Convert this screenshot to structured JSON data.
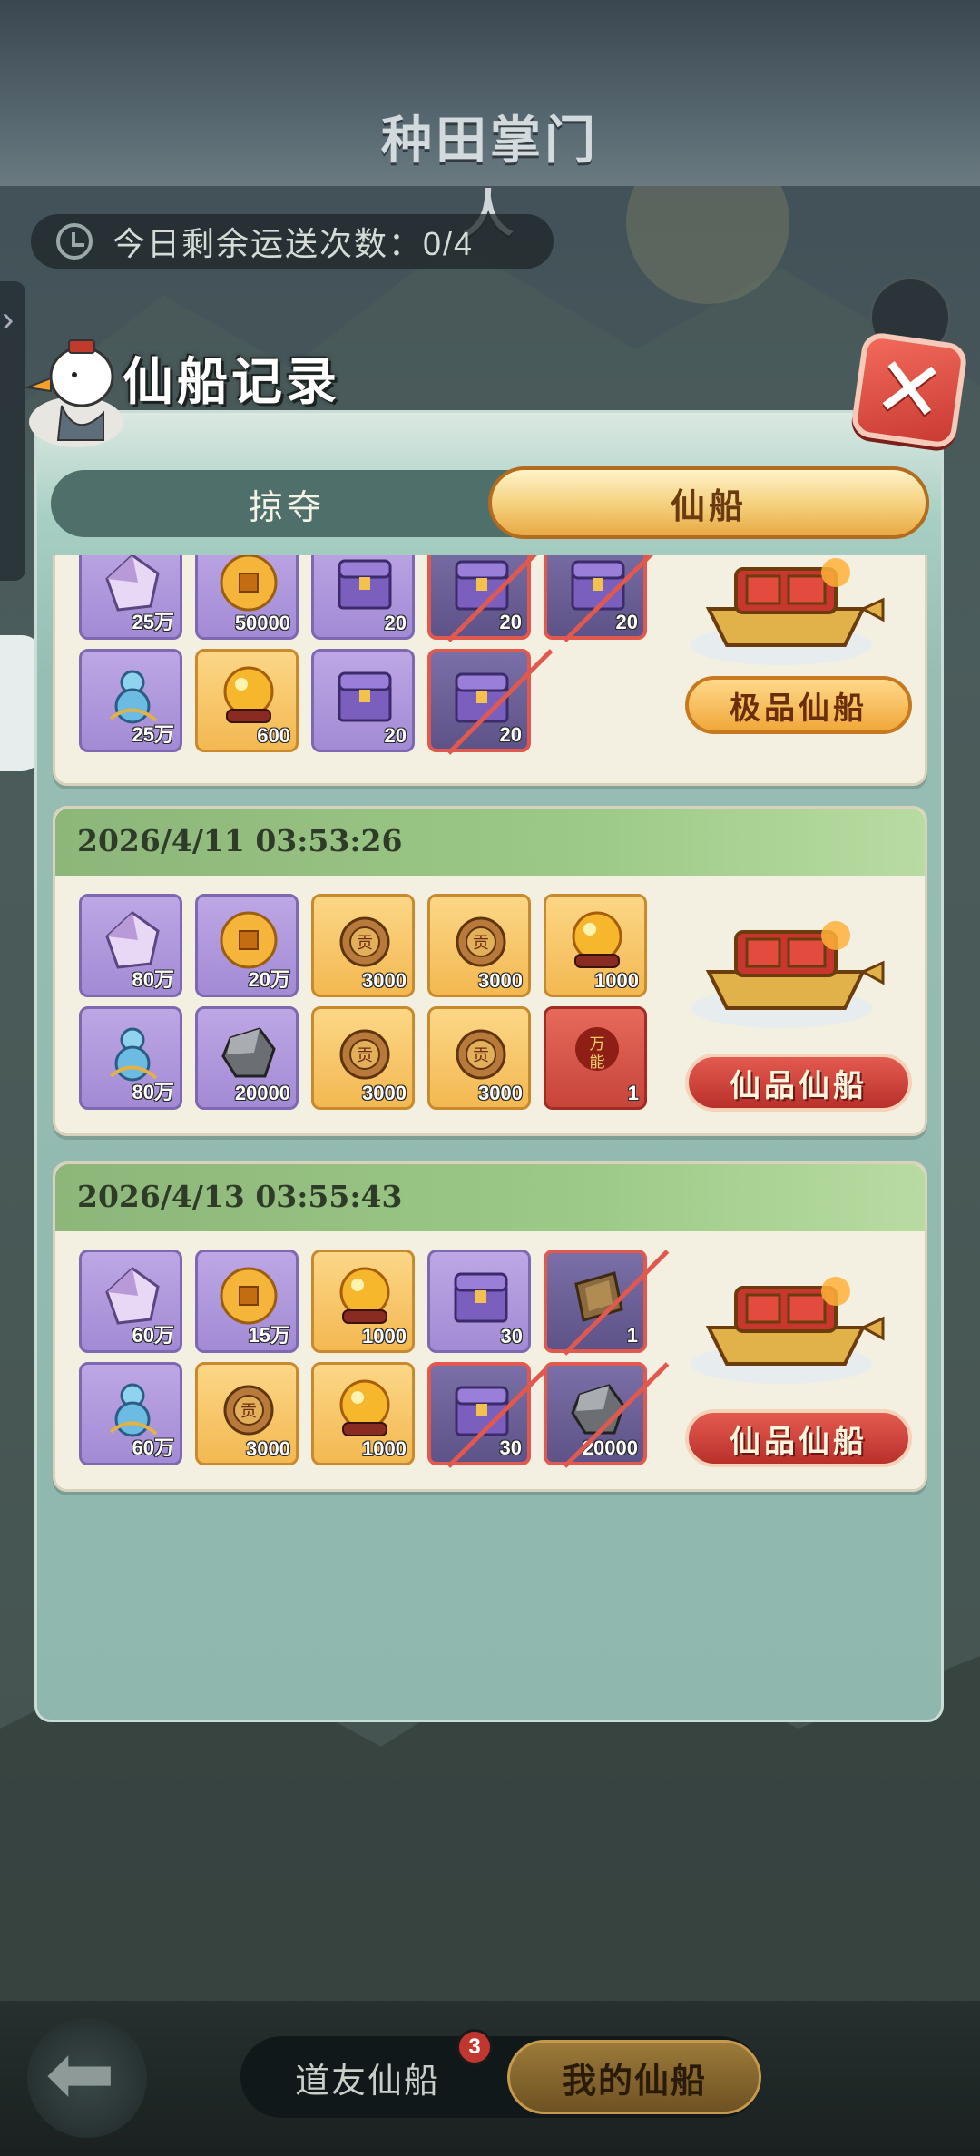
{
  "app": {
    "logo_text": "种田掌门人"
  },
  "header": {
    "remaining_label": "今日剩余运送次数：0/4",
    "record_label": "记录"
  },
  "panel": {
    "title": "仙船记录",
    "close_icon": "close-icon"
  },
  "tabs": [
    {
      "label": "掠夺",
      "active": false
    },
    {
      "label": "仙船",
      "active": true
    }
  ],
  "records": [
    {
      "timestamp": "",
      "ship_label": "极品仙船",
      "ship_tier": "ultimate",
      "items": [
        {
          "icon": "purple-crystal-icon",
          "qty": "25万",
          "rarity": "purple",
          "claimed": false
        },
        {
          "icon": "gold-coin-icon",
          "qty": "50000",
          "rarity": "purple",
          "claimed": false
        },
        {
          "icon": "purple-chest-icon",
          "qty": "20",
          "rarity": "purple",
          "claimed": false
        },
        {
          "icon": "purple-chest-icon",
          "qty": "20",
          "rarity": "purple",
          "claimed": true
        },
        {
          "icon": "purple-chest-icon",
          "qty": "20",
          "rarity": "purple",
          "claimed": true
        },
        {
          "icon": "blue-gourd-icon",
          "qty": "25万",
          "rarity": "purple",
          "claimed": false
        },
        {
          "icon": "golden-orb-icon",
          "qty": "600",
          "rarity": "gold",
          "claimed": false
        },
        {
          "icon": "purple-chest-icon",
          "qty": "20",
          "rarity": "purple",
          "claimed": false
        },
        {
          "icon": "purple-chest-icon",
          "qty": "20",
          "rarity": "purple",
          "claimed": true
        }
      ]
    },
    {
      "timestamp": "2026/4/11 03:53:26",
      "ship_label": "仙品仙船",
      "ship_tier": "immortal",
      "items": [
        {
          "icon": "purple-crystal-icon",
          "qty": "80万",
          "rarity": "purple",
          "claimed": false
        },
        {
          "icon": "gold-coin-icon",
          "qty": "20万",
          "rarity": "purple",
          "claimed": false
        },
        {
          "icon": "tribute-medal-icon",
          "qty": "3000",
          "rarity": "gold",
          "claimed": false
        },
        {
          "icon": "tribute-medal-icon",
          "qty": "3000",
          "rarity": "gold",
          "claimed": false
        },
        {
          "icon": "golden-orb-icon",
          "qty": "1000",
          "rarity": "gold",
          "claimed": false
        },
        {
          "icon": "blue-gourd-icon",
          "qty": "80万",
          "rarity": "purple",
          "claimed": false
        },
        {
          "icon": "iron-ore-icon",
          "qty": "20000",
          "rarity": "purple",
          "claimed": false
        },
        {
          "icon": "tribute-medal-icon",
          "qty": "3000",
          "rarity": "gold",
          "claimed": false
        },
        {
          "icon": "tribute-medal-icon",
          "qty": "3000",
          "rarity": "gold",
          "claimed": false
        },
        {
          "icon": "universal-shard-icon",
          "qty": "1",
          "rarity": "red",
          "claimed": false,
          "label": "万能"
        }
      ]
    },
    {
      "timestamp": "2026/4/13 03:55:43",
      "ship_label": "仙品仙船",
      "ship_tier": "immortal",
      "items": [
        {
          "icon": "purple-crystal-icon",
          "qty": "60万",
          "rarity": "purple",
          "claimed": false
        },
        {
          "icon": "gold-coin-icon",
          "qty": "15万",
          "rarity": "purple",
          "claimed": false
        },
        {
          "icon": "golden-orb-icon",
          "qty": "1000",
          "rarity": "gold",
          "claimed": false
        },
        {
          "icon": "purple-chest-icon",
          "qty": "30",
          "rarity": "purple",
          "claimed": false
        },
        {
          "icon": "bronze-plate-icon",
          "qty": "1",
          "rarity": "red",
          "claimed": true
        },
        {
          "icon": "blue-gourd-icon",
          "qty": "60万",
          "rarity": "purple",
          "claimed": false
        },
        {
          "icon": "tribute-medal-icon",
          "qty": "3000",
          "rarity": "gold",
          "claimed": false
        },
        {
          "icon": "golden-orb-icon",
          "qty": "1000",
          "rarity": "gold",
          "claimed": false
        },
        {
          "icon": "purple-chest-icon",
          "qty": "30",
          "rarity": "purple",
          "claimed": true
        },
        {
          "icon": "iron-ore-icon",
          "qty": "20000",
          "rarity": "purple",
          "claimed": true
        }
      ]
    }
  ],
  "bottom_nav": {
    "back_icon": "back-arrow-icon",
    "friend_ships": "道友仙船",
    "my_ships": "我的仙船",
    "friend_badge": "3"
  },
  "colors": {
    "gold_tab": "#f4cf7a",
    "card_head": "#9cc987",
    "immortal_btn": "#c33a32"
  }
}
